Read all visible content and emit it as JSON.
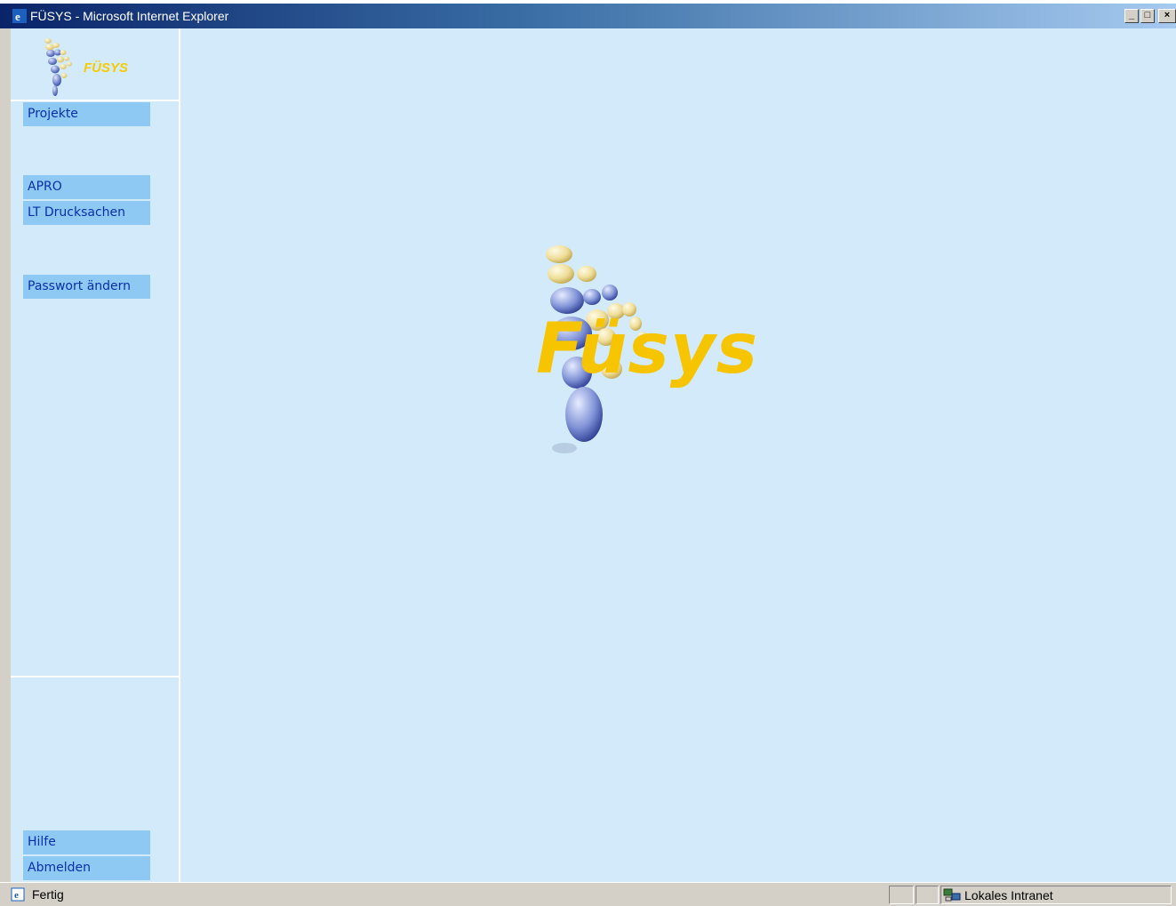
{
  "window": {
    "title": "FÜSYS - Microsoft Internet Explorer",
    "icon": "ie-icon",
    "controls": {
      "minimize": "_",
      "maximize": "□",
      "close": "×"
    }
  },
  "sidebar": {
    "logo_text": "FÜSYS",
    "nav": [
      {
        "label": "Projekte"
      },
      {
        "label": "APRO"
      },
      {
        "label": "LT Drucksachen"
      },
      {
        "label": "Passwort ändern"
      }
    ],
    "bottom_nav": [
      {
        "label": "Hilfe"
      },
      {
        "label": "Abmelden"
      }
    ]
  },
  "main": {
    "brand_text": "Füsys"
  },
  "statusbar": {
    "status": "Fertig",
    "zone": "Lokales Intranet"
  },
  "colors": {
    "background": "#d3eafa",
    "nav_button": "#8ec9f3",
    "nav_text": "#0a2fa8",
    "brand_yellow": "#f7c500"
  }
}
